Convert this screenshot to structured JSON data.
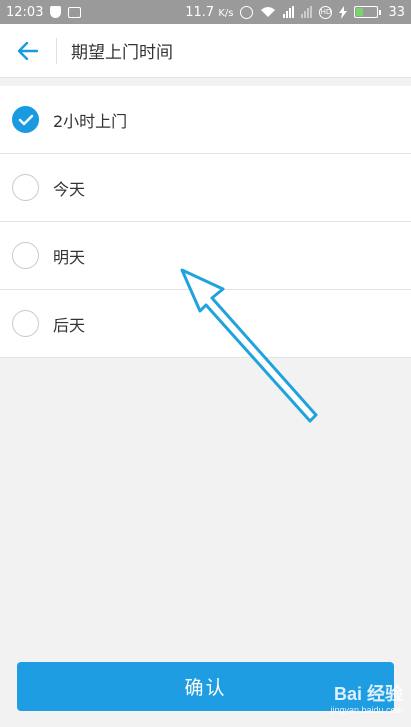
{
  "status_bar": {
    "time": "12:03",
    "net_speed": "11.7",
    "net_unit": "K/s",
    "battery": "33",
    "battery_color": "#7cd26b"
  },
  "header": {
    "back_icon": "arrow-left-icon",
    "title": "期望上门时间"
  },
  "options": [
    {
      "label": "2小时上门",
      "selected": true
    },
    {
      "label": "今天",
      "selected": false
    },
    {
      "label": "明天",
      "selected": false
    },
    {
      "label": "后天",
      "selected": false
    }
  ],
  "confirm_button": {
    "label": "确认"
  },
  "watermark": {
    "main": "Bai 经验",
    "sub": "jingyan.baidu.com"
  },
  "colors": {
    "accent": "#1a9ae1",
    "button": "#1e9de3",
    "status_bar": "#9a9a9a",
    "annotation_arrow": "#1ea3dc"
  }
}
